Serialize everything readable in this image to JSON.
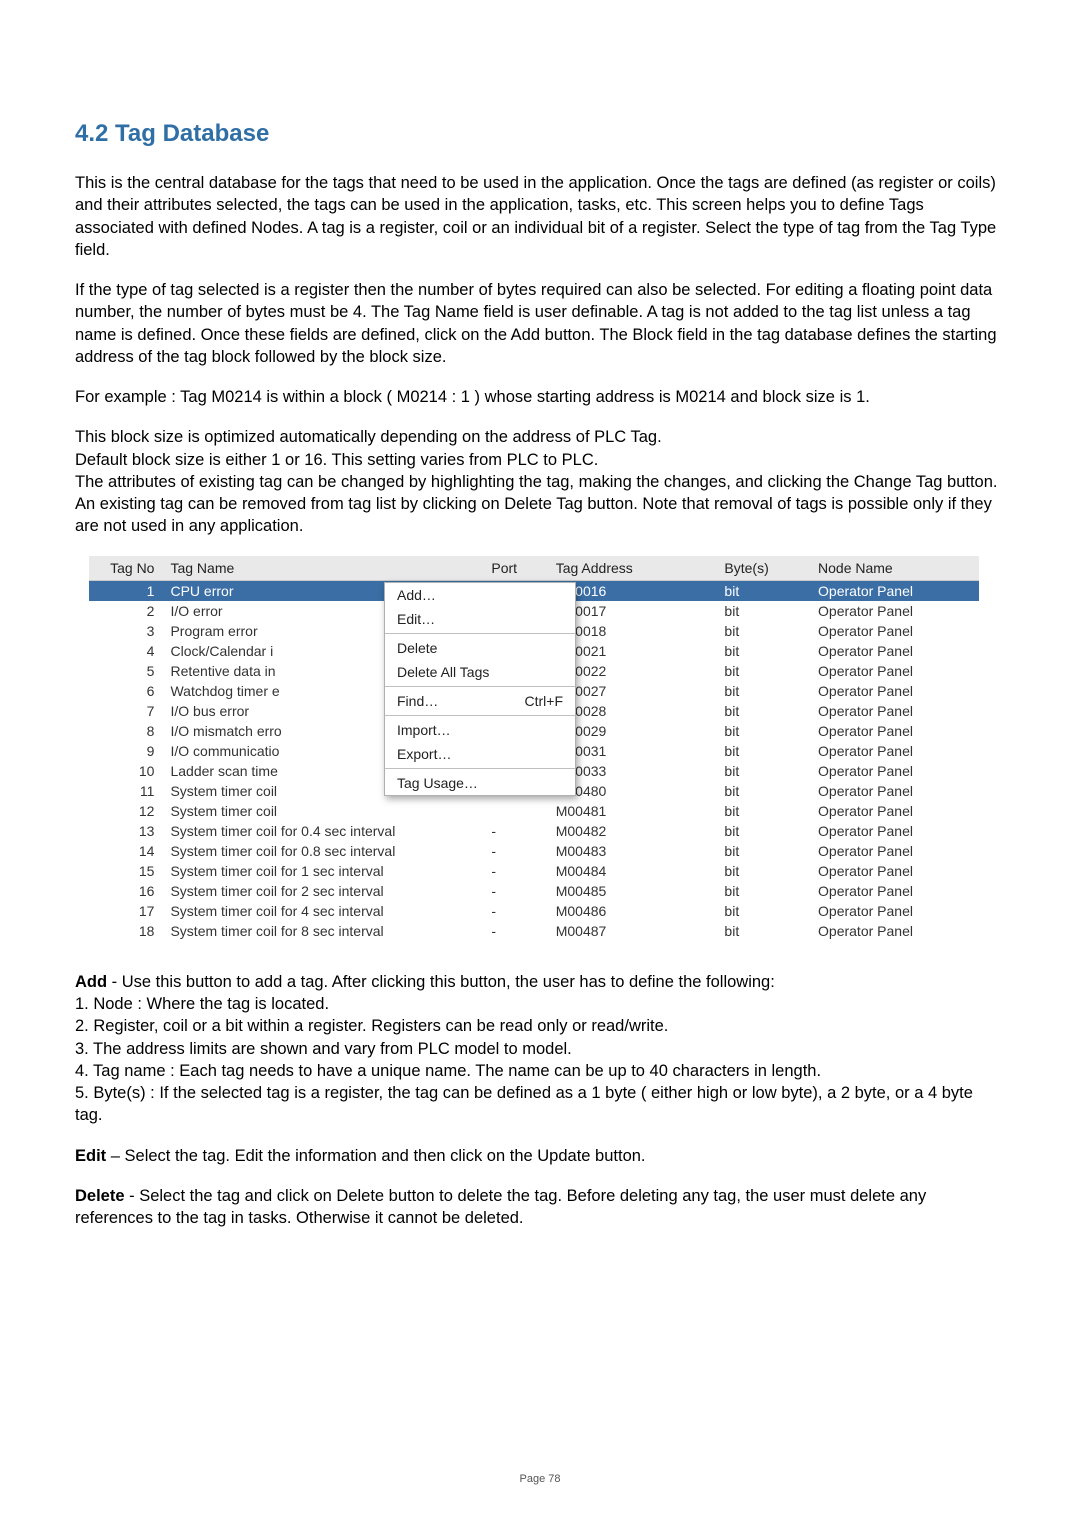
{
  "heading": "4.2  Tag  Database",
  "para1": "This is the central database for the tags that need to be used in the application. Once the tags are defined (as register or coils) and their attributes selected, the tags can be used in the application, tasks, etc. This screen helps you to define Tags associated with defined Nodes. A tag is a register, coil or an individual bit of a register. Select the type of tag from the Tag Type field.",
  "para2": "If the type of tag selected is a register then the number of bytes required can also be selected. For editing a floating point data number, the number of bytes must be 4. The Tag Name field is user definable. A tag is not added to the tag list unless a tag name is defined. Once these fields are defined, click on the Add button. The Block field in the tag database defines the starting address of the tag block followed by the block size.",
  "para3": "For example : Tag M0214 is within a block ( M0214 : 1 ) whose starting address is M0214 and block size is 1.",
  "para4a": "This block size is optimized automatically depending on the address of PLC Tag.",
  "para4b": "Default block size is either 1 or 16. This setting varies from PLC to PLC.",
  "para4c": "The attributes of existing tag can be changed by highlighting the tag, making the changes, and clicking the Change Tag button. An existing tag can be removed from tag list by clicking on Delete Tag button. Note that removal of tags is possible only if they are not used in any application.",
  "table": {
    "headers": {
      "no": "Tag No",
      "name": "Tag Name",
      "port": "Port",
      "addr": "Tag Address",
      "bytes": "Byte(s)",
      "node": "Node Name"
    },
    "rows": [
      {
        "no": "1",
        "name": "CPU error",
        "port": "-",
        "addr": "M00016",
        "bytes": "bit",
        "node": "Operator Panel",
        "sel": true
      },
      {
        "no": "2",
        "name": "I/O error",
        "port": "",
        "addr": "M00017",
        "bytes": "bit",
        "node": "Operator Panel"
      },
      {
        "no": "3",
        "name": "Program error",
        "port": "",
        "addr": "M00018",
        "bytes": "bit",
        "node": "Operator Panel"
      },
      {
        "no": "4",
        "name": "Clock/Calendar i",
        "port": "",
        "addr": "M00021",
        "bytes": "bit",
        "node": "Operator Panel"
      },
      {
        "no": "5",
        "name": "Retentive data in",
        "port": "",
        "addr": "M00022",
        "bytes": "bit",
        "node": "Operator Panel"
      },
      {
        "no": "6",
        "name": "Watchdog timer e",
        "port": "",
        "addr": "M00027",
        "bytes": "bit",
        "node": "Operator Panel"
      },
      {
        "no": "7",
        "name": "I/O bus error",
        "port": "",
        "addr": "M00028",
        "bytes": "bit",
        "node": "Operator Panel"
      },
      {
        "no": "8",
        "name": "I/O mismatch erro",
        "port": "",
        "addr": "M00029",
        "bytes": "bit",
        "node": "Operator Panel"
      },
      {
        "no": "9",
        "name": "I/O communicatio",
        "port": "",
        "addr": "M00031",
        "bytes": "bit",
        "node": "Operator Panel"
      },
      {
        "no": "10",
        "name": "Ladder scan time",
        "port": "",
        "addr": "M00033",
        "bytes": "bit",
        "node": "Operator Panel"
      },
      {
        "no": "11",
        "name": "System timer coil",
        "port": "",
        "addr": "M00480",
        "bytes": "bit",
        "node": "Operator Panel"
      },
      {
        "no": "12",
        "name": "System timer coil",
        "port": "",
        "addr": "M00481",
        "bytes": "bit",
        "node": "Operator Panel"
      },
      {
        "no": "13",
        "name": "System timer coil for 0.4 sec interval",
        "port": "-",
        "addr": "M00482",
        "bytes": "bit",
        "node": "Operator Panel"
      },
      {
        "no": "14",
        "name": "System timer coil for 0.8 sec interval",
        "port": "-",
        "addr": "M00483",
        "bytes": "bit",
        "node": "Operator Panel"
      },
      {
        "no": "15",
        "name": "System timer coil for 1 sec interval",
        "port": "-",
        "addr": "M00484",
        "bytes": "bit",
        "node": "Operator Panel"
      },
      {
        "no": "16",
        "name": "System timer coil for 2 sec interval",
        "port": "-",
        "addr": "M00485",
        "bytes": "bit",
        "node": "Operator Panel"
      },
      {
        "no": "17",
        "name": "System timer coil for 4 sec interval",
        "port": "-",
        "addr": "M00486",
        "bytes": "bit",
        "node": "Operator Panel"
      },
      {
        "no": "18",
        "name": "System timer coil for 8 sec interval",
        "port": "-",
        "addr": "M00487",
        "bytes": "bit",
        "node": "Operator Panel"
      }
    ]
  },
  "menu": {
    "add": "Add…",
    "edit": "Edit…",
    "delete": "Delete",
    "delall": "Delete All Tags",
    "find": "Find…",
    "find_sc": "Ctrl+F",
    "import": "Import…",
    "export": "Export…",
    "usage": "Tag Usage…"
  },
  "add_label": "Add",
  "add_text": " - Use this button to add a tag. After clicking this button, the user has to define the following:",
  "add_1": "1. Node : Where the tag is located.",
  "add_2": "2. Register, coil or a bit within a register. Registers can be read only or read/write.",
  "add_3": "3. The address limits are shown and vary from PLC model to model.",
  "add_4": "4. Tag name : Each tag needs to have a unique name. The name can be up to 40 characters in length.",
  "add_5": "5. Byte(s) : If the selected tag is a register, the tag can be defined as a 1 byte ( either high or low byte), a 2 byte, or a 4 byte tag.",
  "edit_label": "Edit",
  "edit_text": " – Select the tag. Edit the information and then click on the Update button.",
  "del_label": "Delete",
  "del_text": " - Select the tag and click on Delete button to delete the tag. Before deleting any tag, the user must delete any references to the tag in tasks. Otherwise it cannot be deleted.",
  "footer": "Page 78"
}
